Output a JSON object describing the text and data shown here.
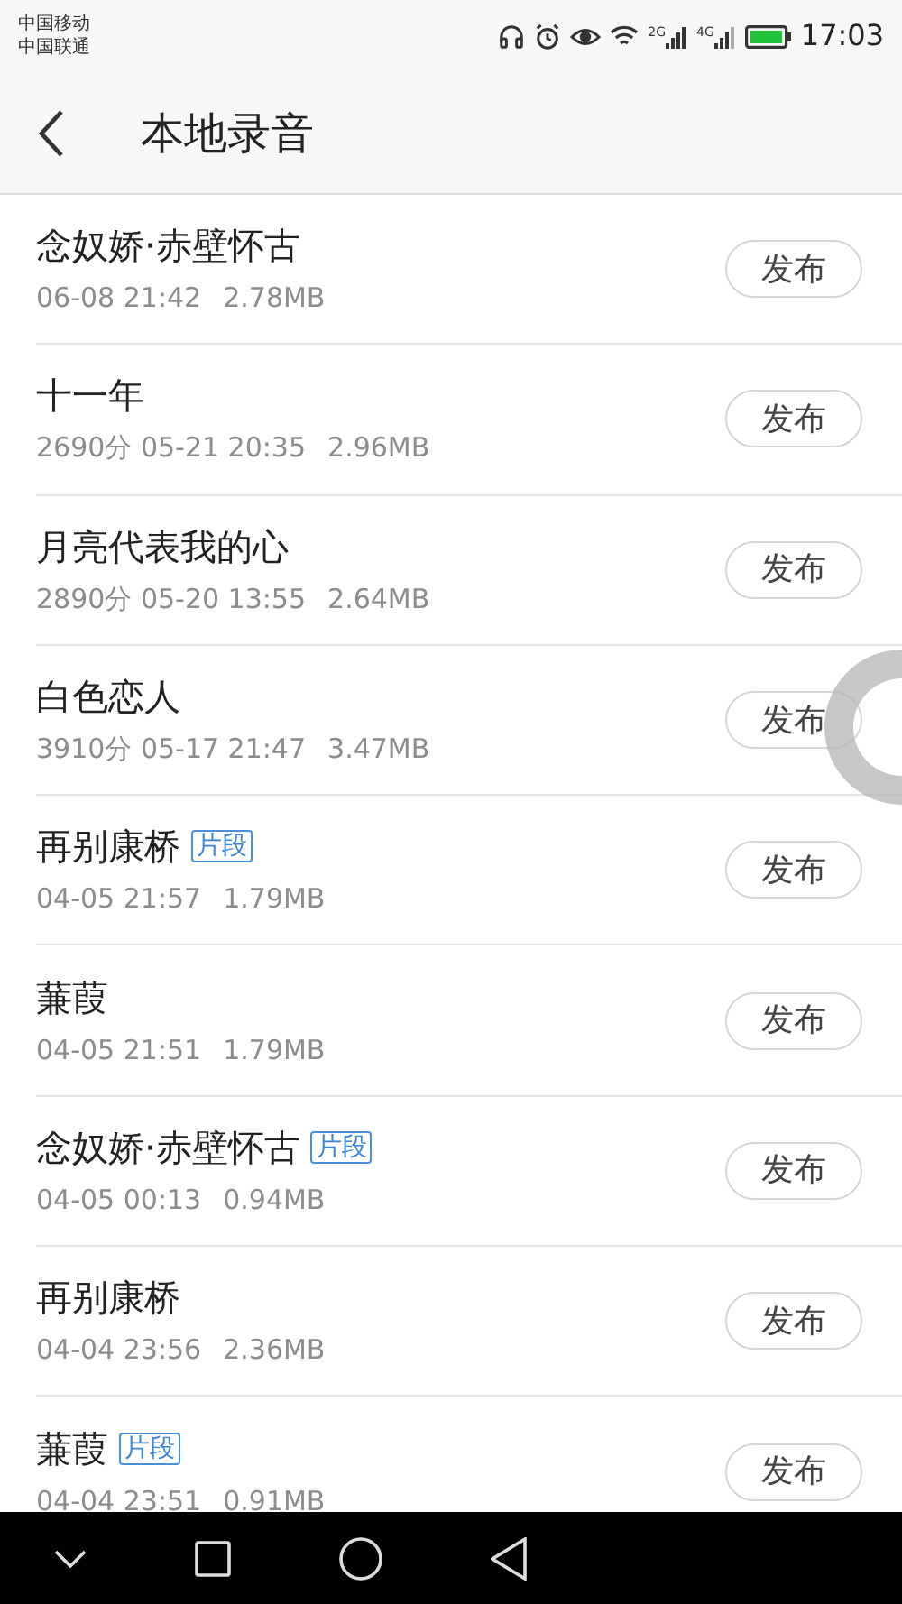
{
  "status_bar": {
    "carriers": [
      "中国移动",
      "中国联通"
    ],
    "network_1": "2G",
    "network_2": "4G",
    "time": "17:03"
  },
  "header": {
    "title": "本地录音"
  },
  "recordings": [
    {
      "title": "念奴娇·赤壁怀古",
      "info": "06-08 21:42",
      "size": "2.78MB",
      "action": "发布"
    },
    {
      "title": "十一年",
      "info": "2690分 05-21 20:35",
      "size": "2.96MB",
      "action": "发布"
    },
    {
      "title": "月亮代表我的心",
      "info": "2890分 05-20 13:55",
      "size": "2.64MB",
      "action": "发布"
    },
    {
      "title": "白色恋人",
      "info": "3910分 05-17 21:47",
      "size": "3.47MB",
      "action": "发布"
    },
    {
      "title": "再别康桥",
      "badge": "片段",
      "info": "04-05 21:57",
      "size": "1.79MB",
      "action": "发布"
    },
    {
      "title": "蒹葭",
      "info": "04-05 21:51",
      "size": "1.79MB",
      "action": "发布"
    },
    {
      "title": "念奴娇·赤壁怀古",
      "badge": "片段",
      "info": "04-05 00:13",
      "size": "0.94MB",
      "action": "发布"
    },
    {
      "title": "再别康桥",
      "info": "04-04 23:56",
      "size": "2.36MB",
      "action": "发布"
    },
    {
      "title": "蒹葭",
      "badge": "片段",
      "info": "04-04 23:51",
      "size": "0.91MB",
      "action": "发布"
    }
  ]
}
